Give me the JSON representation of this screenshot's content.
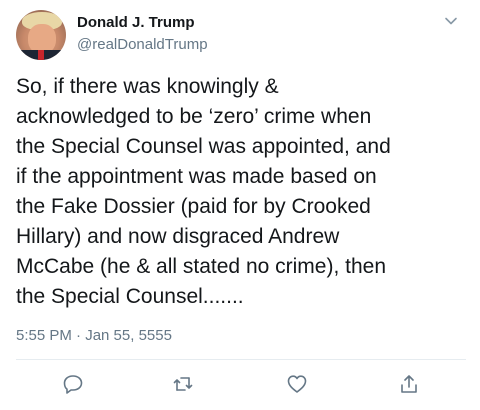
{
  "tweet": {
    "author_name": "Donald J. Trump",
    "author_handle": "@realDonaldTrump",
    "text": "So, if there was knowingly &\nacknowledged to be ‘zero’ crime when\nthe Special Counsel was appointed, and\nif the appointment was made based on\nthe Fake Dossier (paid for by Crooked\nHillary) and now disgraced Andrew\nMcCabe (he & all stated no crime), then\nthe Special Counsel.......",
    "timestamp": "5:55 PM · Jan 55, 5555"
  },
  "icons": {
    "menu": "chevron-down-icon",
    "reply": "reply-icon",
    "retweet": "retweet-icon",
    "like": "heart-icon",
    "share": "share-icon"
  },
  "colors": {
    "text": "#14171a",
    "secondary": "#657786",
    "divider": "#e6ecf0",
    "icon": "#657786"
  }
}
